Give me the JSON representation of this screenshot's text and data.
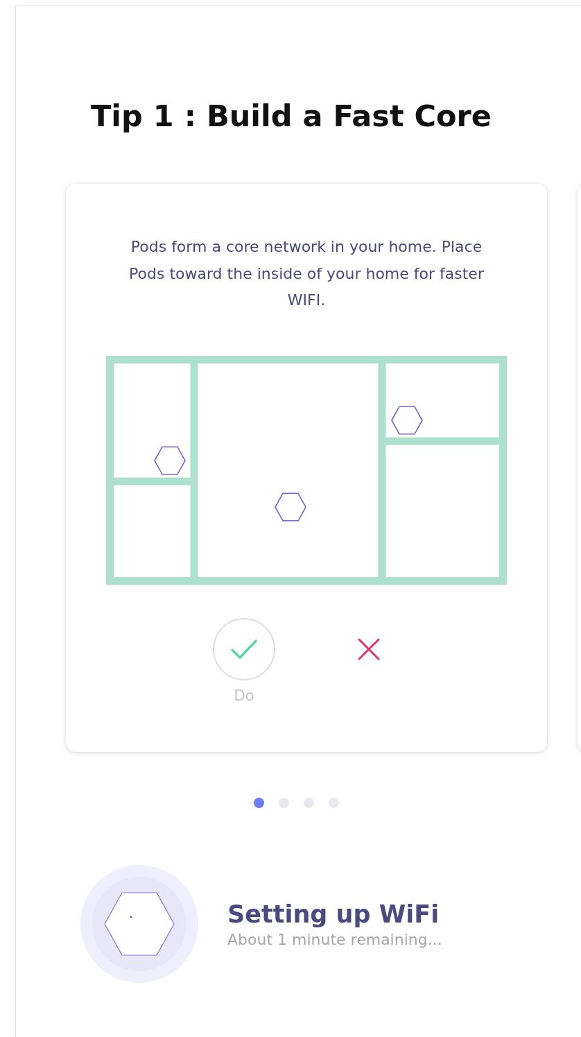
{
  "title": "Tip 1 : Build a Fast Core",
  "card": {
    "description": "Pods form a core network in your home. Place Pods toward the inside of your home for faster WIFI.",
    "options": [
      {
        "kind": "do",
        "selected": true,
        "label": "Do"
      },
      {
        "kind": "dont",
        "selected": false
      }
    ]
  },
  "pages": [
    {
      "selected": true
    },
    {
      "selected": false
    },
    {
      "selected": false
    },
    {
      "selected": false
    }
  ],
  "status": {
    "title": "Setting up WiFi",
    "subtitle": "About 1 minute remaining..."
  }
}
